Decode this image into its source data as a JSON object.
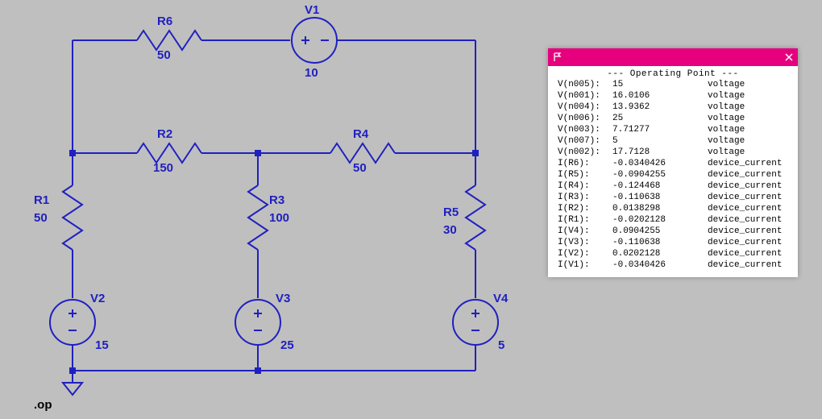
{
  "colors": {
    "wire": "#2020c0",
    "text": "#2020c0",
    "accent": "#e6007e",
    "bg": "#bfbfbf"
  },
  "directive": ".op",
  "components": {
    "R6": {
      "name": "R6",
      "value": "50"
    },
    "V1": {
      "name": "V1",
      "value": "10"
    },
    "R2": {
      "name": "R2",
      "value": "150"
    },
    "R4": {
      "name": "R4",
      "value": "50"
    },
    "R1": {
      "name": "R1",
      "value": "50"
    },
    "R3": {
      "name": "R3",
      "value": "100"
    },
    "R5": {
      "name": "R5",
      "value": "30"
    },
    "V2": {
      "name": "V2",
      "value": "15"
    },
    "V3": {
      "name": "V3",
      "value": "25"
    },
    "V4": {
      "name": "V4",
      "value": "5"
    }
  },
  "opwin": {
    "title": "--- Operating Point ---",
    "rows": [
      {
        "name": "V(n005):",
        "value": "15",
        "unit": "voltage"
      },
      {
        "name": "V(n001):",
        "value": "16.0106",
        "unit": "voltage"
      },
      {
        "name": "V(n004):",
        "value": "13.9362",
        "unit": "voltage"
      },
      {
        "name": "V(n006):",
        "value": "25",
        "unit": "voltage"
      },
      {
        "name": "V(n003):",
        "value": "7.71277",
        "unit": "voltage"
      },
      {
        "name": "V(n007):",
        "value": "5",
        "unit": "voltage"
      },
      {
        "name": "V(n002):",
        "value": "17.7128",
        "unit": "voltage"
      },
      {
        "name": "I(R6):",
        "value": "-0.0340426",
        "unit": "device_current"
      },
      {
        "name": "I(R5):",
        "value": "-0.0904255",
        "unit": "device_current"
      },
      {
        "name": "I(R4):",
        "value": "-0.124468",
        "unit": "device_current"
      },
      {
        "name": "I(R3):",
        "value": "-0.110638",
        "unit": "device_current"
      },
      {
        "name": "I(R2):",
        "value": "0.0138298",
        "unit": "device_current"
      },
      {
        "name": "I(R1):",
        "value": "-0.0202128",
        "unit": "device_current"
      },
      {
        "name": "I(V4):",
        "value": "0.0904255",
        "unit": "device_current"
      },
      {
        "name": "I(V3):",
        "value": "-0.110638",
        "unit": "device_current"
      },
      {
        "name": "I(V2):",
        "value": "0.0202128",
        "unit": "device_current"
      },
      {
        "name": "I(V1):",
        "value": "-0.0340426",
        "unit": "device_current"
      }
    ]
  }
}
